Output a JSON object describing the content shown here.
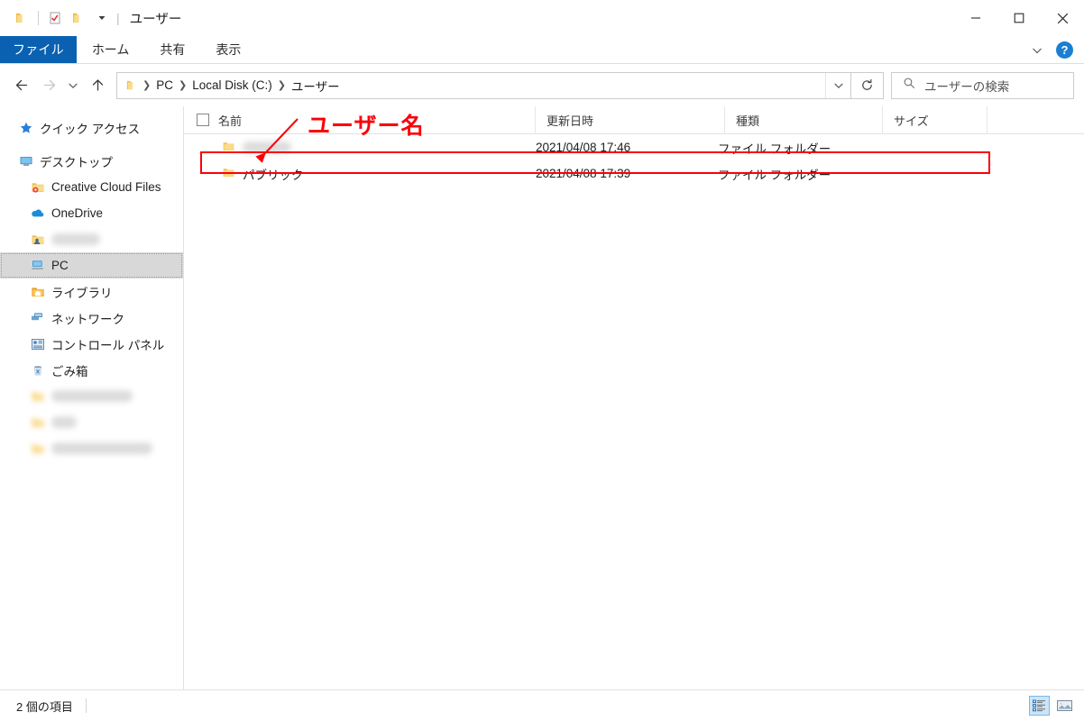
{
  "window": {
    "title": "ユーザー",
    "quick_access": [
      {
        "name": "folder-icon",
        "label": "フォルダー"
      },
      {
        "name": "properties-icon",
        "label": "プロパティ"
      },
      {
        "name": "new-folder-icon",
        "label": "新しいフォルダー"
      },
      {
        "name": "customize-qat-chevron-icon",
        "label": "▾"
      }
    ],
    "controls": {
      "minimize": "—",
      "maximize": "□",
      "close": "✕"
    }
  },
  "ribbon": {
    "tabs": [
      {
        "label": "ファイル",
        "active": true
      },
      {
        "label": "ホーム",
        "active": false
      },
      {
        "label": "共有",
        "active": false
      },
      {
        "label": "表示",
        "active": false
      }
    ],
    "collapse_label": "リボンを最小化",
    "help_label": "?"
  },
  "nav": {
    "back_label": "戻る",
    "forward_label": "進む",
    "recent_label": "最近表示した場所",
    "up_label": "上へ",
    "breadcrumb": [
      {
        "label": "PC"
      },
      {
        "label": "Local Disk (C:)"
      },
      {
        "label": "ユーザー"
      }
    ],
    "dropdown_label": "▾",
    "refresh_label": "最新の情報に更新"
  },
  "search": {
    "placeholder": "ユーザーの検索",
    "icon": "search-icon"
  },
  "sidebar": {
    "items": [
      {
        "label": "クイック アクセス",
        "icon": "star-icon",
        "indent": 0,
        "selected": false,
        "redacted": false,
        "group": true
      },
      {
        "label": "デスクトップ",
        "icon": "desktop-icon",
        "indent": 0,
        "selected": false,
        "redacted": false
      },
      {
        "label": "Creative Cloud Files",
        "icon": "creative-cloud-folder-icon",
        "indent": 1,
        "selected": false,
        "redacted": false
      },
      {
        "label": "OneDrive",
        "icon": "onedrive-icon",
        "indent": 1,
        "selected": false,
        "redacted": false
      },
      {
        "label": "",
        "icon": "user-folder-icon",
        "indent": 1,
        "selected": false,
        "redacted": true,
        "redact_width": 54
      },
      {
        "label": "PC",
        "icon": "pc-icon",
        "indent": 1,
        "selected": true,
        "redacted": false
      },
      {
        "label": "ライブラリ",
        "icon": "library-icon",
        "indent": 1,
        "selected": false,
        "redacted": false
      },
      {
        "label": "ネットワーク",
        "icon": "network-icon",
        "indent": 1,
        "selected": false,
        "redacted": false
      },
      {
        "label": "コントロール パネル",
        "icon": "control-panel-icon",
        "indent": 1,
        "selected": false,
        "redacted": false
      },
      {
        "label": "ごみ箱",
        "icon": "recycle-bin-icon",
        "indent": 1,
        "selected": false,
        "redacted": false
      },
      {
        "label": "",
        "icon": "folder-icon",
        "indent": 1,
        "selected": false,
        "redacted": true,
        "redact_width": 90
      },
      {
        "label": "",
        "icon": "folder-icon",
        "indent": 1,
        "selected": false,
        "redacted": true,
        "redact_width": 28
      },
      {
        "label": "",
        "icon": "folder-icon",
        "indent": 1,
        "selected": false,
        "redacted": true,
        "redact_width": 112
      }
    ]
  },
  "filelist": {
    "select_all_label": "すべて選択",
    "columns": [
      {
        "label": "名前"
      },
      {
        "label": "更新日時"
      },
      {
        "label": "種類"
      },
      {
        "label": "サイズ"
      }
    ],
    "rows": [
      {
        "name": "",
        "redacted": true,
        "redact_width": 54,
        "date": "2021/04/08 17:46",
        "type": "ファイル フォルダー",
        "size": "",
        "highlighted": true
      },
      {
        "name": "パブリック",
        "redacted": false,
        "date": "2021/04/08 17:39",
        "type": "ファイル フォルダー",
        "size": "",
        "highlighted": false
      }
    ]
  },
  "status": {
    "item_count": "2 個の項目",
    "views": [
      {
        "name": "details-view-icon",
        "label": "詳細表示",
        "active": true
      },
      {
        "name": "large-icons-view-icon",
        "label": "大アイコン表示",
        "active": false
      }
    ]
  },
  "annotation": {
    "label": "ユーザー名",
    "color": "#fb0007"
  }
}
